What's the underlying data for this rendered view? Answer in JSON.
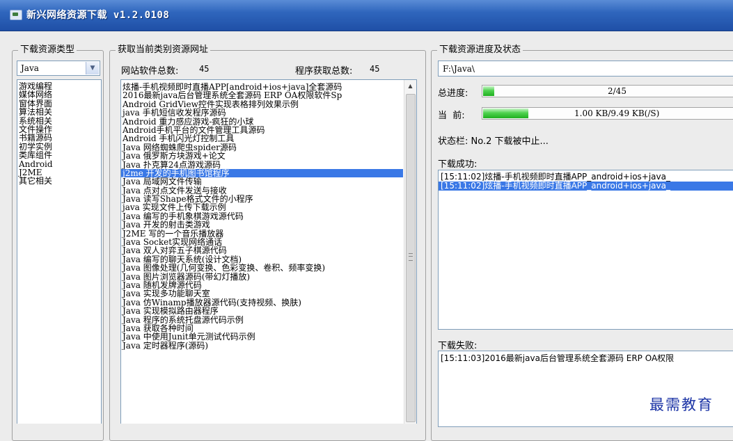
{
  "window": {
    "title": "新兴网络资源下载 v1.2.0108"
  },
  "category_group": {
    "legend": "下载资源类型",
    "selected": "Java",
    "items": [
      "游戏编程",
      "媒体网络",
      "窗体界面",
      "算法相关",
      "系统相关",
      "文件操作",
      "书籍源码",
      "初学实例",
      "类库组件",
      "Android",
      "J2ME",
      "其它相关"
    ]
  },
  "resource_group": {
    "legend": "获取当前类别资源网址",
    "site_total_label": "网站软件总数:",
    "site_total_value": "45",
    "program_total_label": "程序获取总数:",
    "program_total_value": "45",
    "selected_index": 10,
    "items": [
      "炫播-手机视频即时直播APP[android+ios+java]全套源码",
      "2016最新java后台管理系统全套源码 ERP OA权限软件Sp",
      "Android GridView控件实现表格排列效果示例",
      "java 手机短信收发程序源码",
      "Android 重力感应游戏-疯狂的小球",
      "Android手机平台的文件管理工具源码",
      "Android 手机闪光灯控制工具",
      "Java 网络蜘蛛爬虫spider源码",
      "Java 俄罗斯方块游戏+论文",
      "Java 扑克算24点游戏源码",
      "j2me 开发的手机图书馆程序",
      "Java 局域网文件传输",
      "Java 点对点文件发送与接收",
      "Java 读写Shape格式文件的小程序",
      "java 实现文件上传下载示例",
      "Java 编写的手机象棋游戏源代码",
      "Java 开发的射击类游戏",
      "J2ME 写的一个音乐播放器",
      "Java Socket实现网络通话",
      "Java 双人对弈五子棋源代码",
      "Java 编写的聊天系统(设计文档)",
      "Java 图像处理(几何变换、色彩变换、卷积、频率变换)",
      "Java 图片浏览器源码(带幻灯播放)",
      "Java 随机发牌源代码",
      "Java 实现多功能聊天室",
      "Java 仿Winamp播放器源代码(支持视频、换肤)",
      "Java 实现模拟路由器程序",
      "Java 程序的系统托盘源代码示例",
      "Java 获取各种时间",
      "Java 中使用Junit单元测试代码示例",
      "Java 定时器程序(源码)"
    ]
  },
  "status_group": {
    "legend": "下载资源进度及状态",
    "path": "F:\\Java\\",
    "total_label": "总进度:",
    "total_text": "2/45",
    "total_fraction": 0.044,
    "current_label": "当  前:",
    "current_text": "1.00 KB/9.49 KB(/S)",
    "current_fraction": 0.18,
    "status_text": "状态栏: No.2 下载被中止...",
    "success_label": "下载成功:",
    "success_items": [
      "[15:11:02]炫播-手机视频即时直播APP_android+ios+java_",
      "[15:11:02]炫播-手机视频即时直播APP_android+ios+java_"
    ],
    "failure_label": "下载失败:",
    "failure_items": [
      "[15:11:03]2016最新java后台管理系统全套源码 ERP OA权限"
    ]
  },
  "watermark": "最需教育",
  "colors": {
    "titlebar": "#2f66bd",
    "selection": "#3a78e6",
    "progress_fill": "#20b020",
    "watermark": "#1d35a6"
  }
}
